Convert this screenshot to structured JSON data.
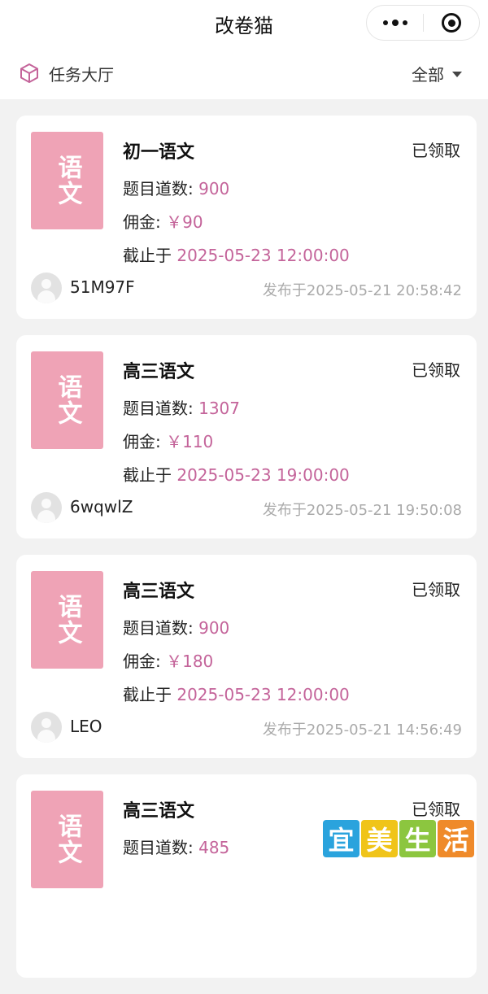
{
  "app": {
    "title": "改卷猫"
  },
  "subbar": {
    "hall_label": "任务大厅",
    "filter_label": "全部"
  },
  "labels": {
    "count": "题目道数:",
    "fee": "佣金:",
    "deadline": "截止于"
  },
  "tasks": [
    {
      "cover": "语文",
      "name": "初一语文",
      "status": "已领取",
      "count": "900",
      "fee": "￥90",
      "deadline": "2025-05-23 12:00:00",
      "user": "51M97F",
      "published": "发布于2025-05-21 20:58:42"
    },
    {
      "cover": "语文",
      "name": "高三语文",
      "status": "已领取",
      "count": "1307",
      "fee": "￥110",
      "deadline": "2025-05-23 19:00:00",
      "user": "6wqwlZ",
      "published": "发布于2025-05-21 19:50:08"
    },
    {
      "cover": "语文",
      "name": "高三语文",
      "status": "已领取",
      "count": "900",
      "fee": "￥180",
      "deadline": "2025-05-23 12:00:00",
      "user": "LEO",
      "published": "发布于2025-05-21 14:56:49"
    },
    {
      "cover": "语文",
      "name": "高三语文",
      "status": "已领取",
      "count": "485",
      "fee": "",
      "deadline": "",
      "user": "",
      "published": ""
    }
  ],
  "watermark": {
    "chars": [
      "宜",
      "美",
      "生",
      "活"
    ],
    "colors": [
      "#2aa3dd",
      "#f0c419",
      "#8cc63f",
      "#ef8a2a"
    ]
  },
  "colors": {
    "accent": "#c4649a",
    "cover_bg": "#efa3b6"
  }
}
